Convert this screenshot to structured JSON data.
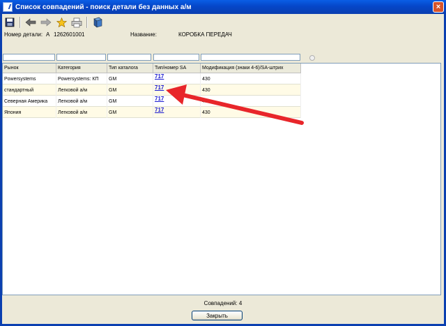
{
  "window": {
    "title": "Список совпадений - поиск детали без данных а/м",
    "close_glyph": "×"
  },
  "toolbar": [
    {
      "name": "save-icon",
      "glyph": "💾"
    },
    {
      "name": "back-icon",
      "glyph": "◀"
    },
    {
      "name": "forward-icon",
      "glyph": "▶"
    },
    {
      "name": "star-icon",
      "glyph": "★"
    },
    {
      "name": "print-icon",
      "glyph": "🖶"
    },
    {
      "name": "book-icon",
      "glyph": "📘"
    }
  ],
  "info": {
    "part_number_label": "Номер детали:",
    "part_number_prefix": "A",
    "part_number_value": "1262601001",
    "name_label": "Название:",
    "name_value": "КОРОБКА ПЕРЕДАЧ"
  },
  "filters": {
    "inputs": [
      "",
      "",
      "",
      "",
      ""
    ]
  },
  "table": {
    "columns": [
      "Рынок",
      "Категория",
      "Тип каталога",
      "Тип/номер SA",
      "Модификация (знаки 4-6)/SA-штрих"
    ],
    "rows": [
      [
        "Powersystems",
        "Powersystems: КП",
        "GM",
        "717",
        "430"
      ],
      [
        "стандартный",
        "Легковой а/м",
        "GM",
        "717",
        "430"
      ],
      [
        "Северная Америка",
        "Легковой а/м",
        "GM",
        "717",
        "430"
      ],
      [
        "Япония",
        "Легковой а/м",
        "GM",
        "717",
        "430"
      ]
    ]
  },
  "footer": {
    "count_label": "Совпадений:",
    "count_value": "4",
    "close_button": "Закрыть"
  },
  "colors": {
    "arrow": "#e8262a",
    "link": "#1a1ad0",
    "titlebar": "#0a5ee6"
  }
}
